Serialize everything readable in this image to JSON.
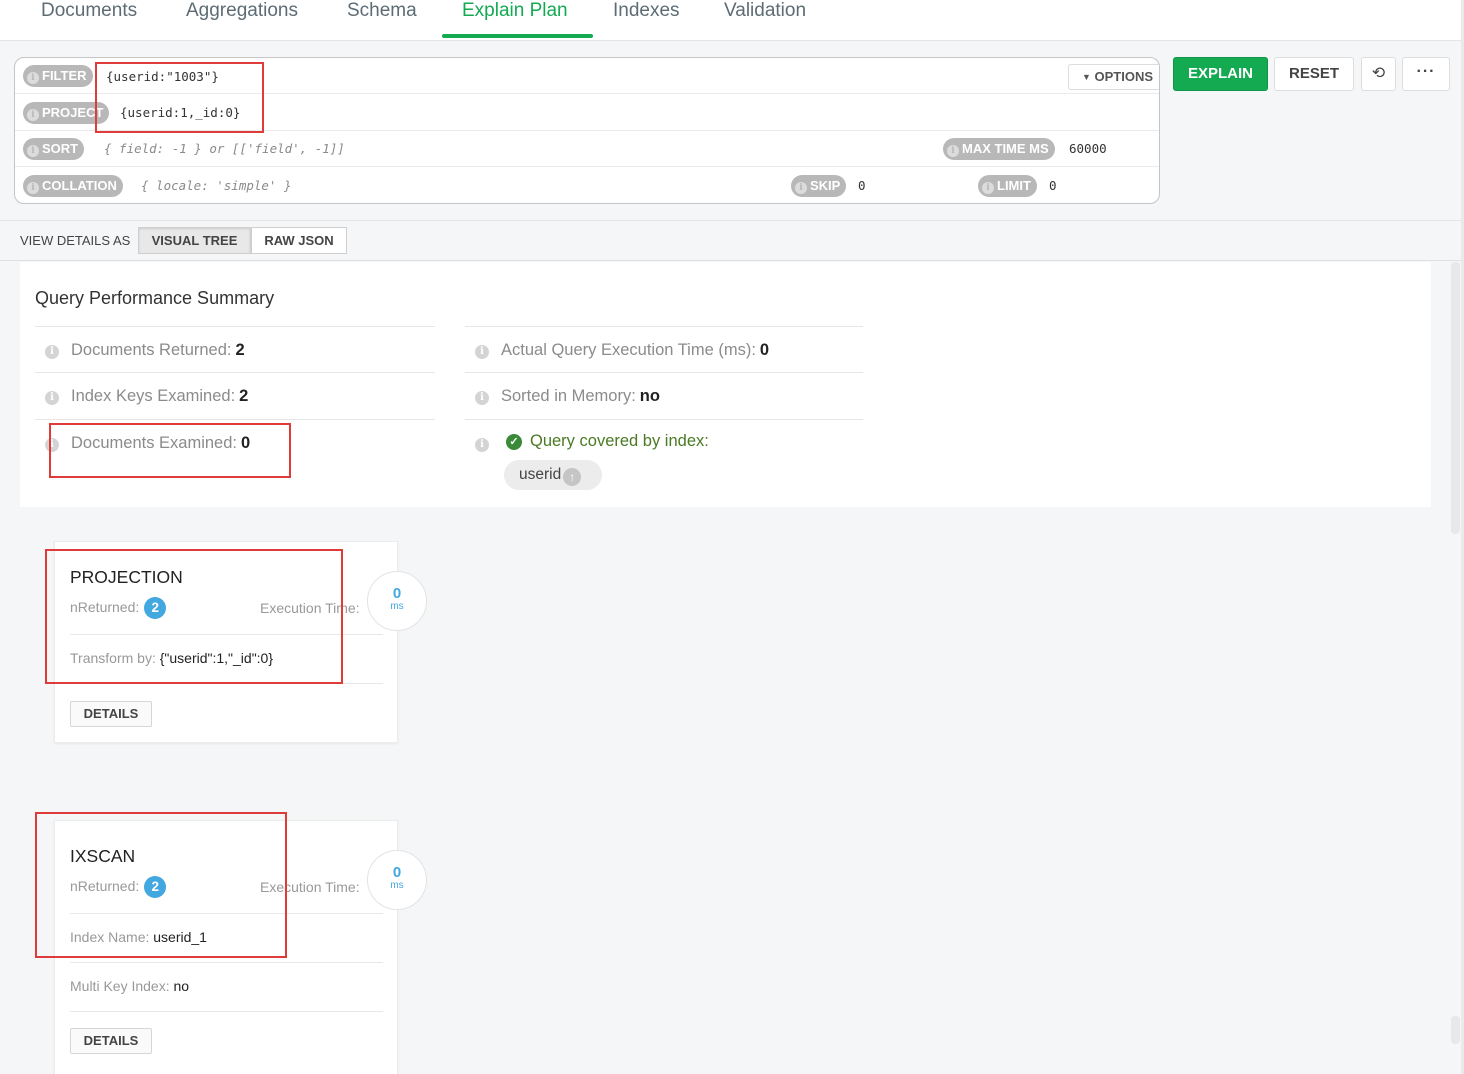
{
  "tabs": [
    "Documents",
    "Aggregations",
    "Schema",
    "Explain Plan",
    "Indexes",
    "Validation"
  ],
  "active_tab": "Explain Plan",
  "query_bar": {
    "filter_label": "FILTER",
    "filter_value": "{userid:\"1003\"}",
    "project_label": "PROJECT",
    "project_value": "{userid:1,_id:0}",
    "sort_label": "SORT",
    "sort_placeholder": "{ field: -1 } or [['field', -1]]",
    "max_time_label": "MAX TIME MS",
    "max_time_value": "60000",
    "collation_label": "COLLATION",
    "collation_placeholder": "{ locale: 'simple' }",
    "skip_label": "SKIP",
    "skip_value": "0",
    "limit_label": "LIMIT",
    "limit_value": "0",
    "options_label": "OPTIONS",
    "explain_label": "EXPLAIN",
    "reset_label": "RESET",
    "history_icon": "history-icon",
    "more_icon": "more-icon",
    "more_label": "···"
  },
  "view_details": {
    "label": "VIEW DETAILS AS",
    "options": [
      "VISUAL TREE",
      "RAW JSON"
    ],
    "selected": "VISUAL TREE"
  },
  "summary": {
    "title": "Query Performance Summary",
    "docs_returned_label": "Documents Returned:",
    "docs_returned": "2",
    "keys_examined_label": "Index Keys Examined:",
    "keys_examined": "2",
    "docs_examined_label": "Documents Examined:",
    "docs_examined": "0",
    "exec_time_label": "Actual Query Execution Time (ms):",
    "exec_time": "0",
    "sorted_label": "Sorted in Memory:",
    "sorted": "no",
    "covered_label": "Query covered by index:",
    "index_pill": "userid"
  },
  "stages": [
    {
      "title": "PROJECTION",
      "nreturned_label": "nReturned:",
      "nreturned": "2",
      "exec_label": "Execution Time:",
      "exec_value": "0",
      "exec_unit": "ms",
      "row1_label": "Transform by:",
      "row1_value": "{\"userid\":1,\"_id\":0}",
      "details_label": "DETAILS"
    },
    {
      "title": "IXSCAN",
      "nreturned_label": "nReturned:",
      "nreturned": "2",
      "exec_label": "Execution Time:",
      "exec_value": "0",
      "exec_unit": "ms",
      "row1_label": "Index Name:",
      "row1_value": "userid_1",
      "row2_label": "Multi Key Index:",
      "row2_value": "no",
      "details_label": "DETAILS"
    }
  ],
  "colors": {
    "accent_green": "#13aa52",
    "badge_blue": "#43a7e0",
    "highlight_red": "#e03b3b"
  }
}
